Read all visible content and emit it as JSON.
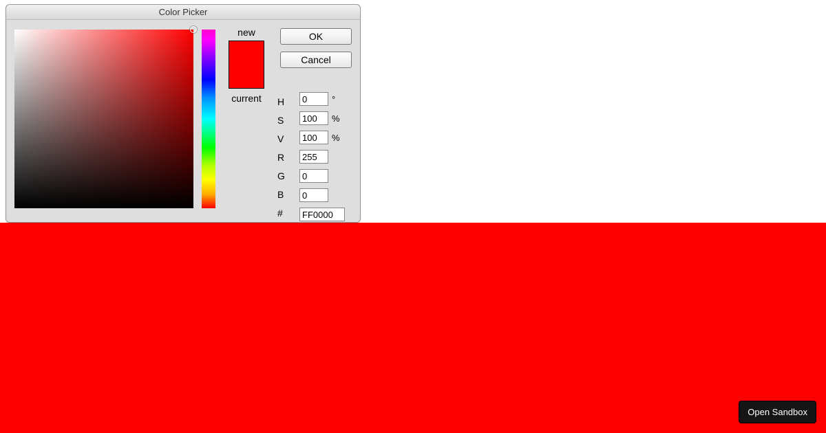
{
  "window": {
    "title": "Color Picker"
  },
  "preview": {
    "new_label": "new",
    "current_label": "current",
    "swatch_color": "#ff0000"
  },
  "buttons": {
    "ok": "OK",
    "cancel": "Cancel"
  },
  "fields": {
    "h": {
      "label": "H",
      "value": "0",
      "suffix": "°"
    },
    "s": {
      "label": "S",
      "value": "100",
      "suffix": "%"
    },
    "v": {
      "label": "V",
      "value": "100",
      "suffix": "%"
    },
    "r": {
      "label": "R",
      "value": "255",
      "suffix": ""
    },
    "g": {
      "label": "G",
      "value": "0",
      "suffix": ""
    },
    "b": {
      "label": "B",
      "value": "0",
      "suffix": ""
    },
    "hex": {
      "label": "#",
      "value": "FF0000"
    }
  },
  "background_color": "#ff0000",
  "sandbox_button_label": "Open Sandbox"
}
